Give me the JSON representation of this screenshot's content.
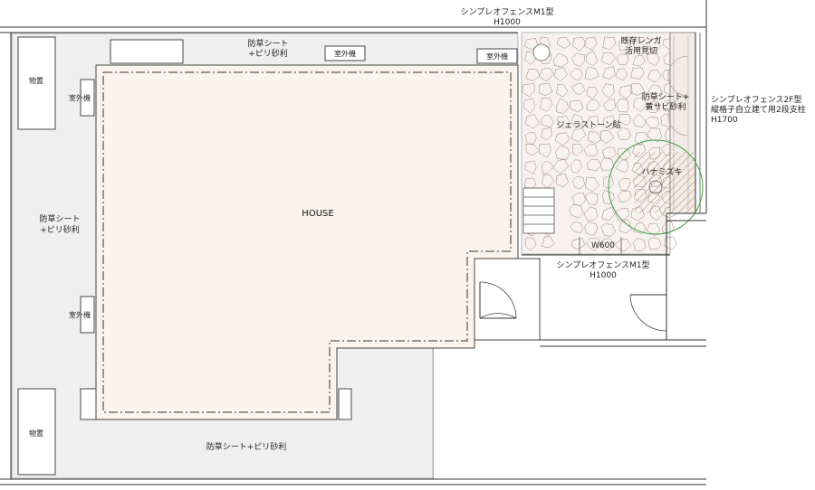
{
  "labels": {
    "fence_top": [
      "シンプレオフェンスM1型",
      "H1000"
    ],
    "fence_mid": [
      "シンプレオフェンスM1型",
      "H1000"
    ],
    "fence_right": [
      "シンプレオフェンス2F型",
      "縦格子自立建て用2段支柱",
      "H1700"
    ],
    "storage_top": "物置",
    "storage_bottom": "物置",
    "outdoor_unit_left_top": "室外機",
    "outdoor_unit_left_bottom": "室外機",
    "outdoor_unit_top_mid": "室外機",
    "outdoor_unit_top_right": "室外機",
    "weed_sheet_top": [
      "防草シート",
      "+ピリ砂利"
    ],
    "weed_sheet_left": [
      "防草シート",
      "+ピリ砂利"
    ],
    "weed_sheet_bottom": "防草シート+ピリ砂利",
    "weed_sheet_yellow": [
      "防草シート+",
      "黄サビ砂利"
    ],
    "existing_brick": [
      "既存レンガ",
      "活用見切"
    ],
    "gelastone": "ジェラストーン貼",
    "dogwood": "ハナミズキ",
    "house": "HOUSE",
    "gate_width": "W600"
  },
  "colors": {
    "house_fill": "#fbf3ec",
    "gravel_fill": "#efefef",
    "stone_line": "#a07c74",
    "tree_circle": "#3aa43a"
  }
}
